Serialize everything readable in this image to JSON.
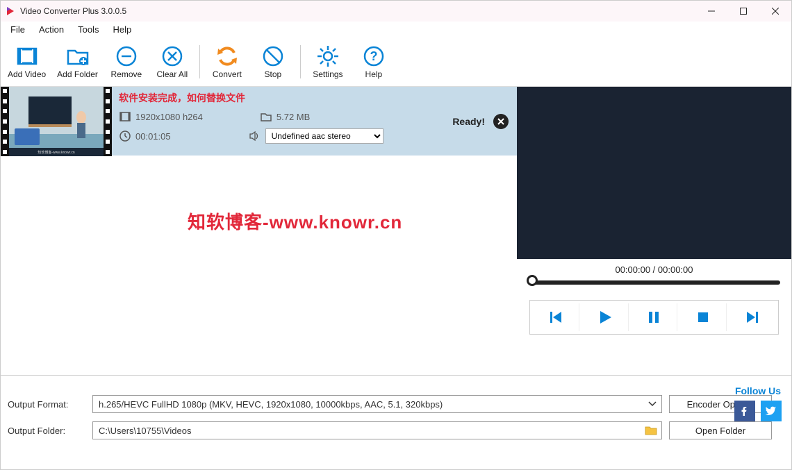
{
  "window": {
    "title": "Video Converter Plus 3.0.0.5"
  },
  "menu": {
    "file": "File",
    "action": "Action",
    "tools": "Tools",
    "help": "Help"
  },
  "toolbar": {
    "add_video": "Add Video",
    "add_folder": "Add Folder",
    "remove": "Remove",
    "clear_all": "Clear All",
    "convert": "Convert",
    "stop": "Stop",
    "settings": "Settings",
    "help": "Help"
  },
  "item": {
    "title": "软件安装完成，如何替换文件",
    "resolution": "1920x1080 h264",
    "size": "5.72 MB",
    "duration": "00:01:05",
    "audio": "Undefined aac stereo",
    "status": "Ready!"
  },
  "watermark": "知软博客-www.knowr.cn",
  "preview": {
    "time": "00:00:00 / 00:00:00"
  },
  "output": {
    "format_label": "Output Format:",
    "format_value": "h.265/HEVC FullHD 1080p (MKV, HEVC, 1920x1080, 10000kbps, AAC, 5.1, 320kbps)",
    "folder_label": "Output Folder:",
    "folder_value": "C:\\Users\\10755\\Videos",
    "encoder_btn": "Encoder Options",
    "open_folder_btn": "Open Folder"
  },
  "follow": {
    "title": "Follow Us"
  }
}
